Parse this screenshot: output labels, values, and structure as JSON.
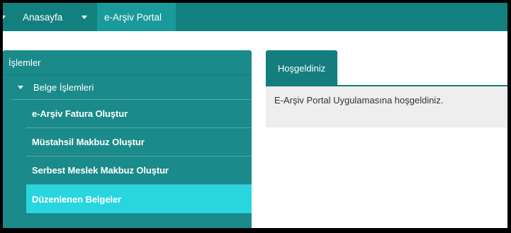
{
  "topnav": {
    "home_label": "Anasayfa",
    "portal_label": "e-Arşiv Portal"
  },
  "sidebar": {
    "header": "İşlemler",
    "group_label": "Belge İşlemleri",
    "items": [
      {
        "label": "e-Arşiv Fatura Oluştur"
      },
      {
        "label": "Müstahsil Makbuz Oluştur"
      },
      {
        "label": "Serbest Meslek Makbuz Oluştur"
      },
      {
        "label": "Düzenlenen Belgeler"
      }
    ]
  },
  "panel": {
    "tab_label": "Hoşgeldiniz",
    "message": "E-Arşiv Portal Uygulamasına hoşgeldiniz."
  },
  "colors": {
    "topbar": "#138080",
    "sidebar": "#1a8a8a",
    "active_item": "#29d6e0"
  }
}
